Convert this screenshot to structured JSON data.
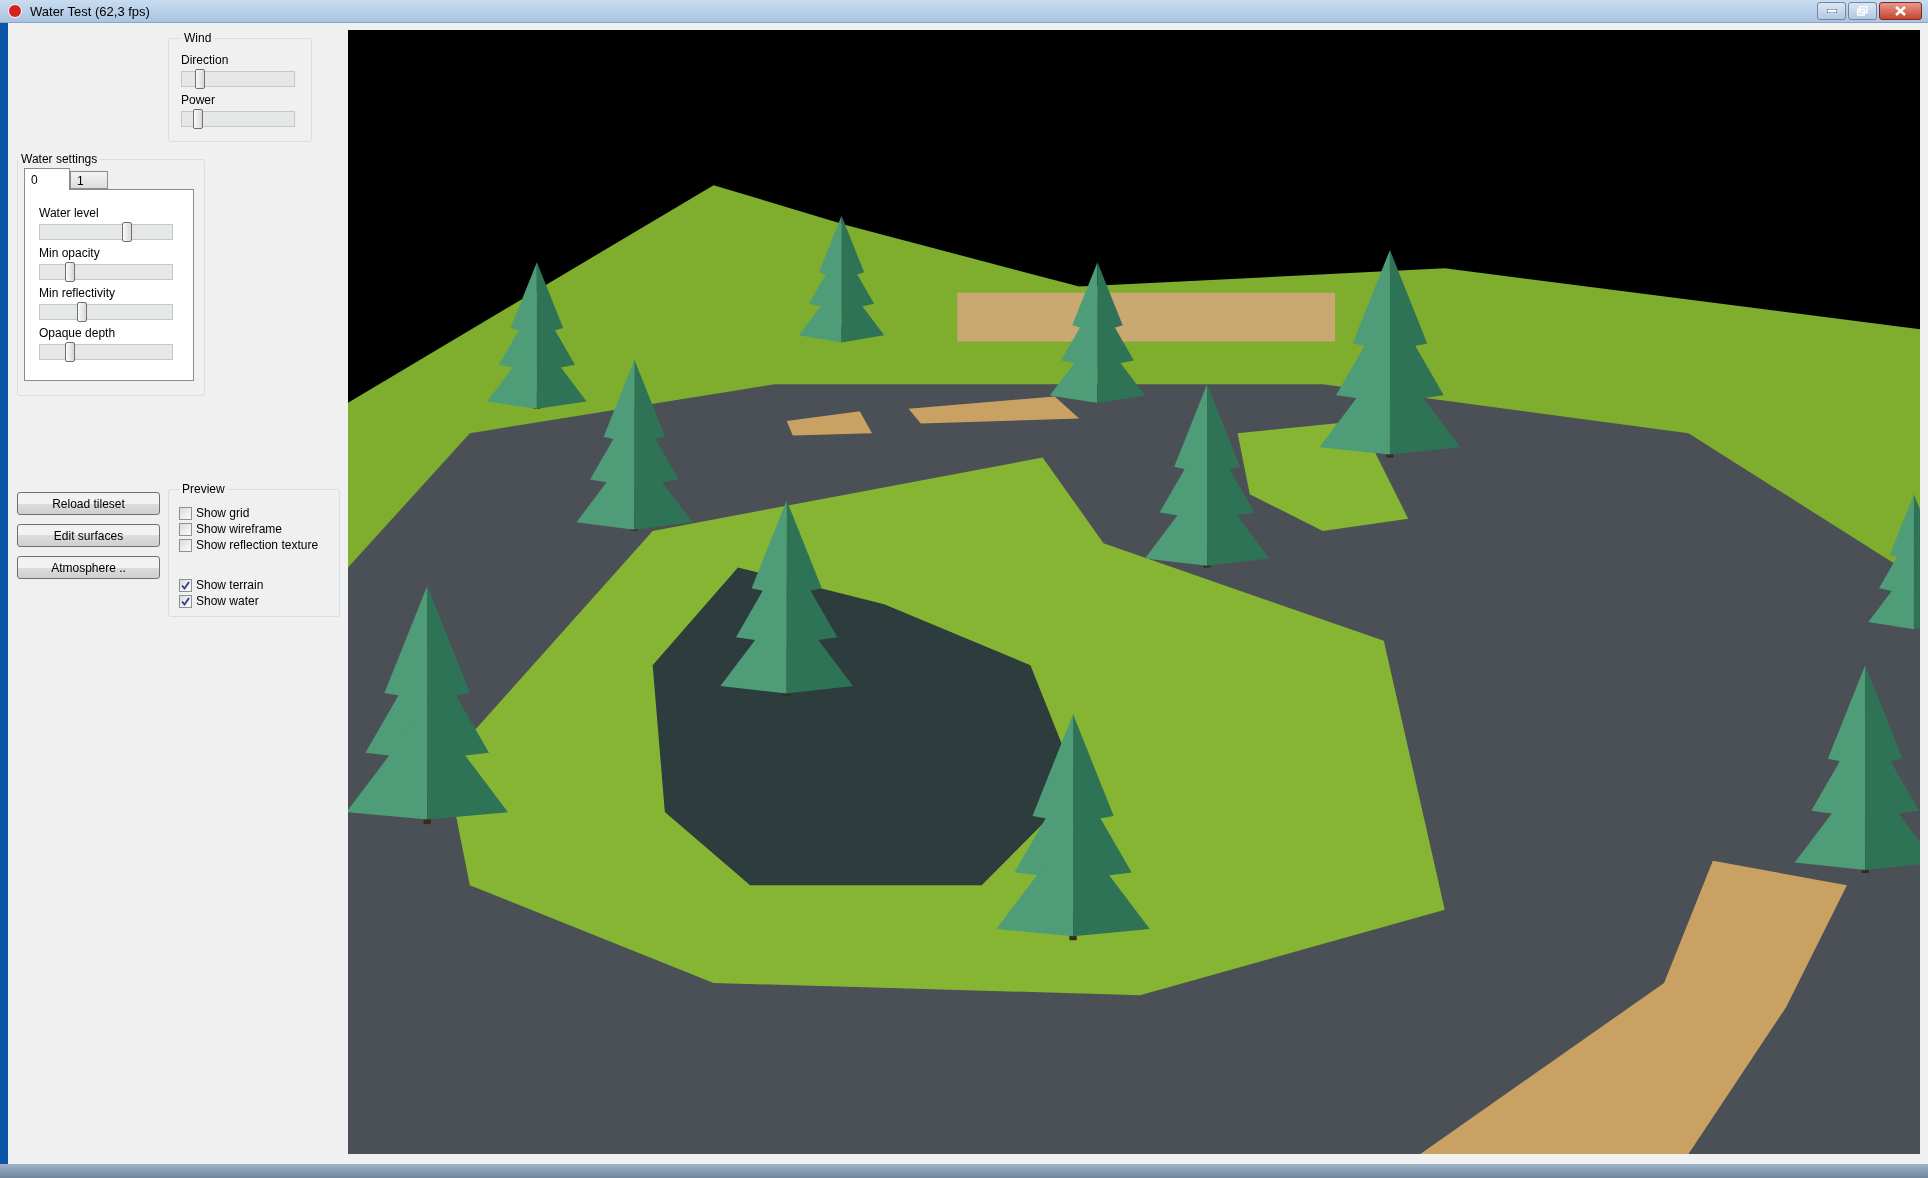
{
  "window": {
    "title": "Water Test (62,3 fps)"
  },
  "wind": {
    "title": "Wind",
    "sliders": [
      {
        "label": "Direction",
        "level": 0.15
      },
      {
        "label": "Power",
        "level": 0.13
      }
    ]
  },
  "water_settings": {
    "title": "Water settings",
    "tabs": [
      {
        "label": "0",
        "selected": true
      },
      {
        "label": "1",
        "selected": false
      }
    ],
    "sliders": [
      {
        "label": "Water level",
        "level": 0.65
      },
      {
        "label": "Min opacity",
        "level": 0.22
      },
      {
        "label": "Min reflectivity",
        "level": 0.31
      },
      {
        "label": "Opaque depth",
        "level": 0.22
      }
    ]
  },
  "buttons": [
    "Reload tileset",
    "Edit surfaces",
    "Atmosphere .."
  ],
  "preview": {
    "title": "Preview",
    "option_groups": [
      [
        {
          "label": "Show grid",
          "checked": false
        },
        {
          "label": "Show wireframe",
          "checked": false
        },
        {
          "label": "Show reflection texture",
          "checked": false
        }
      ],
      [
        {
          "label": "Show terrain",
          "checked": true
        },
        {
          "label": "Show water",
          "checked": true
        }
      ]
    ]
  }
}
